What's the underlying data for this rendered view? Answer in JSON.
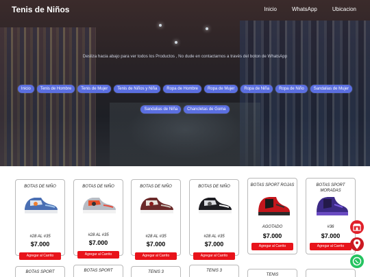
{
  "navbar": {
    "brand": "Tenis de Niños",
    "links": [
      "Inicio",
      "WhatsApp",
      "Ubicacion"
    ]
  },
  "hero": {
    "tagline": "Desliza hacia abajo para ver todos los Productos , No dude en contactarnos a través del boton de WhatsApp"
  },
  "categories": [
    "Inicio",
    "Tenis de Hombre",
    "Tenis de Mujer",
    "Tenis de Niños y Niña",
    "Ropa de Hombre",
    "Ropa de Mujer",
    "Ropa de Niña",
    "Ropa de Niño",
    "Sandalias de Mujer",
    "Sandalias de Niña",
    "Chancletas de Goma"
  ],
  "products": [
    {
      "name": "BOTAS DE NIÑO",
      "size": "#28 AL #35",
      "price": "$7.000",
      "button": "Agregar al Carrito"
    },
    {
      "name": "BOTAS DE NIÑO",
      "size": "#28 AL #35",
      "price": "$7.000",
      "button": "Agregar al Carrito"
    },
    {
      "name": "BOTAS DE NIÑO",
      "size": "#28 AL #35",
      "price": "$7.000",
      "button": "Agregar al Carrito"
    },
    {
      "name": "BOTAS DE NIÑO",
      "size": "#28 AL #35",
      "price": "$7.000",
      "button": "Agregar al Carrito"
    },
    {
      "name": "BOTAS SPORT ROJAS",
      "size": "AGOTADO",
      "price": "$7.000",
      "button": "Agregar al Carrito"
    },
    {
      "name": "BOTAS SPORT MORADAS",
      "size": "#36",
      "price": "$7.000",
      "button": "Agregar al Carrito"
    }
  ],
  "products_row2": [
    "BOTAS SPORT",
    "BOTAS SPORT",
    "TENIS 3",
    "TENIS 3",
    "TENIS",
    ""
  ],
  "colors": {
    "pill": "#5b6fe0",
    "cart_button": "#e8131a",
    "whatsapp": "#25c360"
  }
}
